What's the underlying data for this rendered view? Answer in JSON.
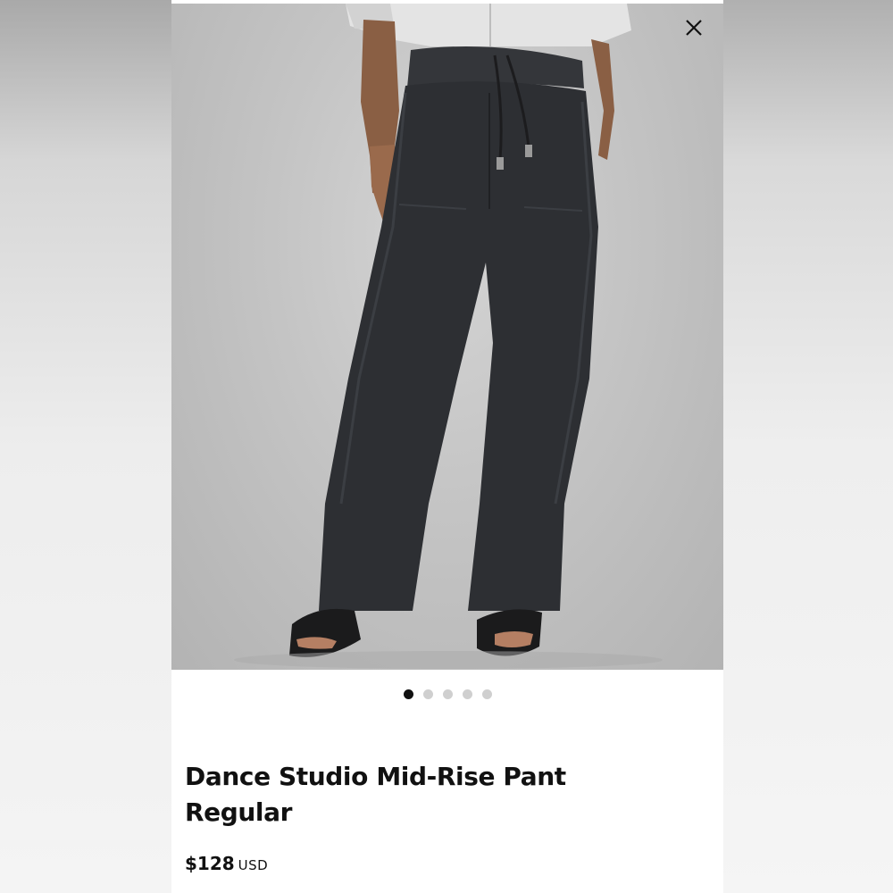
{
  "product": {
    "title_line1": "Dance Studio Mid-Rise Pant",
    "title_line2": "Regular",
    "price": "$128",
    "currency": "USD"
  },
  "gallery": {
    "image_count": 5,
    "active_index": 0
  },
  "icons": {
    "close": "close-icon"
  },
  "colors": {
    "text": "#111111",
    "dot_active": "#111111",
    "dot_inactive": "#cfcfcf",
    "photo_bg": "#c4c4c4",
    "pants": "#2d2f33"
  }
}
